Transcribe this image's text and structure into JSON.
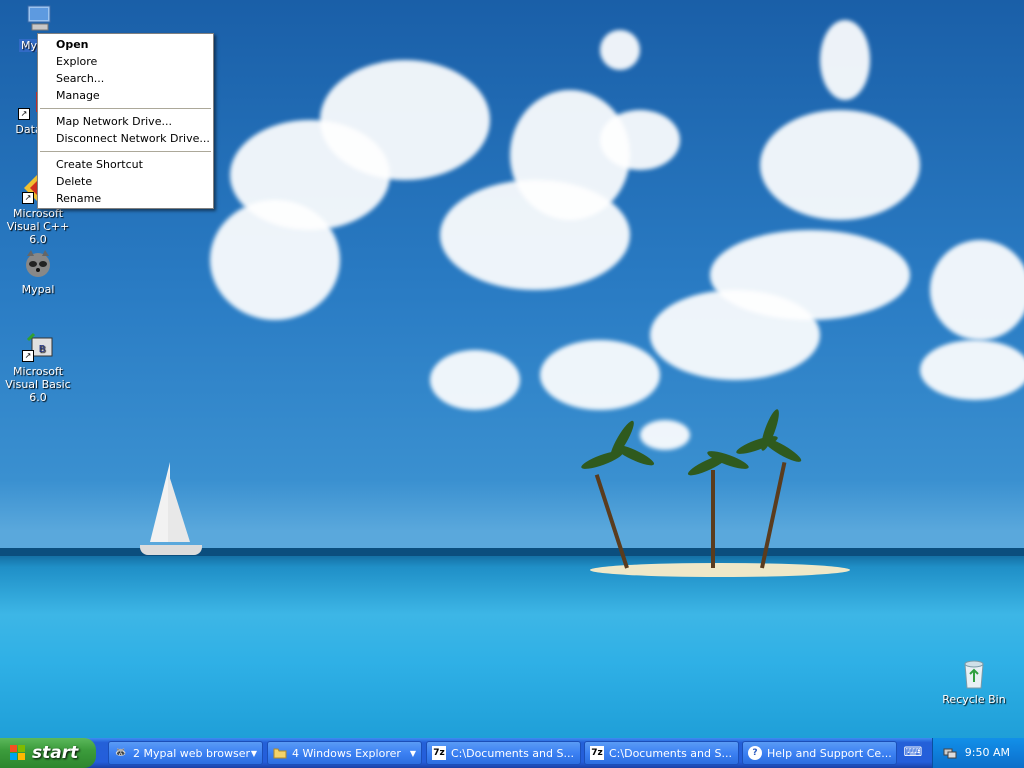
{
  "desktop": {
    "icons": [
      {
        "label": "My Co",
        "icon": "my-computer-icon"
      },
      {
        "label": "DataW",
        "icon": "datawindow-icon"
      },
      {
        "label": "Microsoft Visual C++ 6.0",
        "icon": "visual-cpp-icon"
      },
      {
        "label": "Mypal",
        "icon": "mypal-icon"
      },
      {
        "label": "Microsoft Visual Basic 6.0",
        "icon": "visual-basic-icon"
      },
      {
        "label": "Recycle Bin",
        "icon": "recycle-bin-icon"
      }
    ]
  },
  "context_menu": {
    "items": [
      "Open",
      "Explore",
      "Search...",
      "Manage",
      "Map Network Drive...",
      "Disconnect Network Drive...",
      "Create Shortcut",
      "Delete",
      "Rename"
    ]
  },
  "taskbar": {
    "start_label": "start",
    "tasks": [
      {
        "label": "2 Mypal web browser",
        "icon": "mypal-icon"
      },
      {
        "label": "4 Windows Explorer",
        "icon": "folder-icon"
      },
      {
        "label": "C:\\Documents and S...",
        "icon": "7zip-icon"
      },
      {
        "label": "C:\\Documents and S...",
        "icon": "7zip-icon"
      },
      {
        "label": "Help and Support Ce...",
        "icon": "help-icon"
      }
    ],
    "clock": "9:50 AM",
    "colors": {
      "taskbar": "#245edb",
      "start": "#3c9c3c",
      "tray": "#0f7fdb"
    }
  }
}
